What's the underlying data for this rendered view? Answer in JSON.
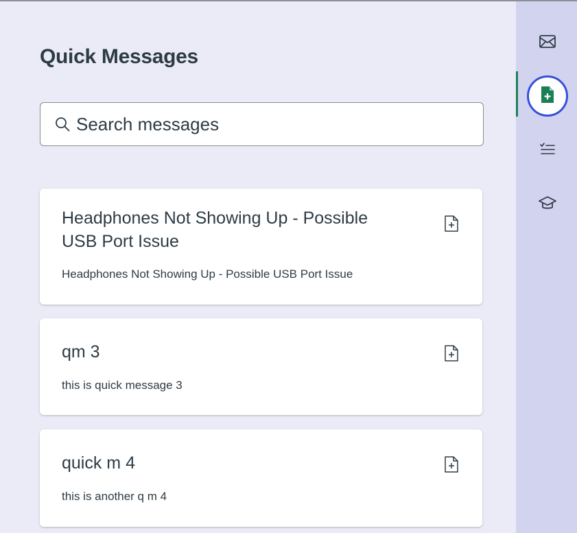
{
  "panel": {
    "title": "Quick Messages",
    "search": {
      "placeholder": "Search messages",
      "value": ""
    }
  },
  "messages": [
    {
      "title": "Headphones Not Showing Up - Possible USB Port Issue",
      "description": "Headphones Not Showing Up - Possible USB Port Issue"
    },
    {
      "title": "qm 3",
      "description": "this is quick message 3"
    },
    {
      "title": "quick m 4",
      "description": "this is another q m 4"
    }
  ],
  "rail": {
    "items": [
      {
        "icon": "inbox-icon",
        "active": false
      },
      {
        "icon": "quick-message-icon",
        "active": true
      },
      {
        "icon": "checklist-icon",
        "active": false
      },
      {
        "icon": "graduation-cap-icon",
        "active": false
      }
    ],
    "active_color": "#3650d8",
    "indicator_color": "#1a7f55"
  },
  "colors": {
    "text": "#2d3b45",
    "background": "#eaebf7",
    "rail_background": "#d2d3ef"
  }
}
